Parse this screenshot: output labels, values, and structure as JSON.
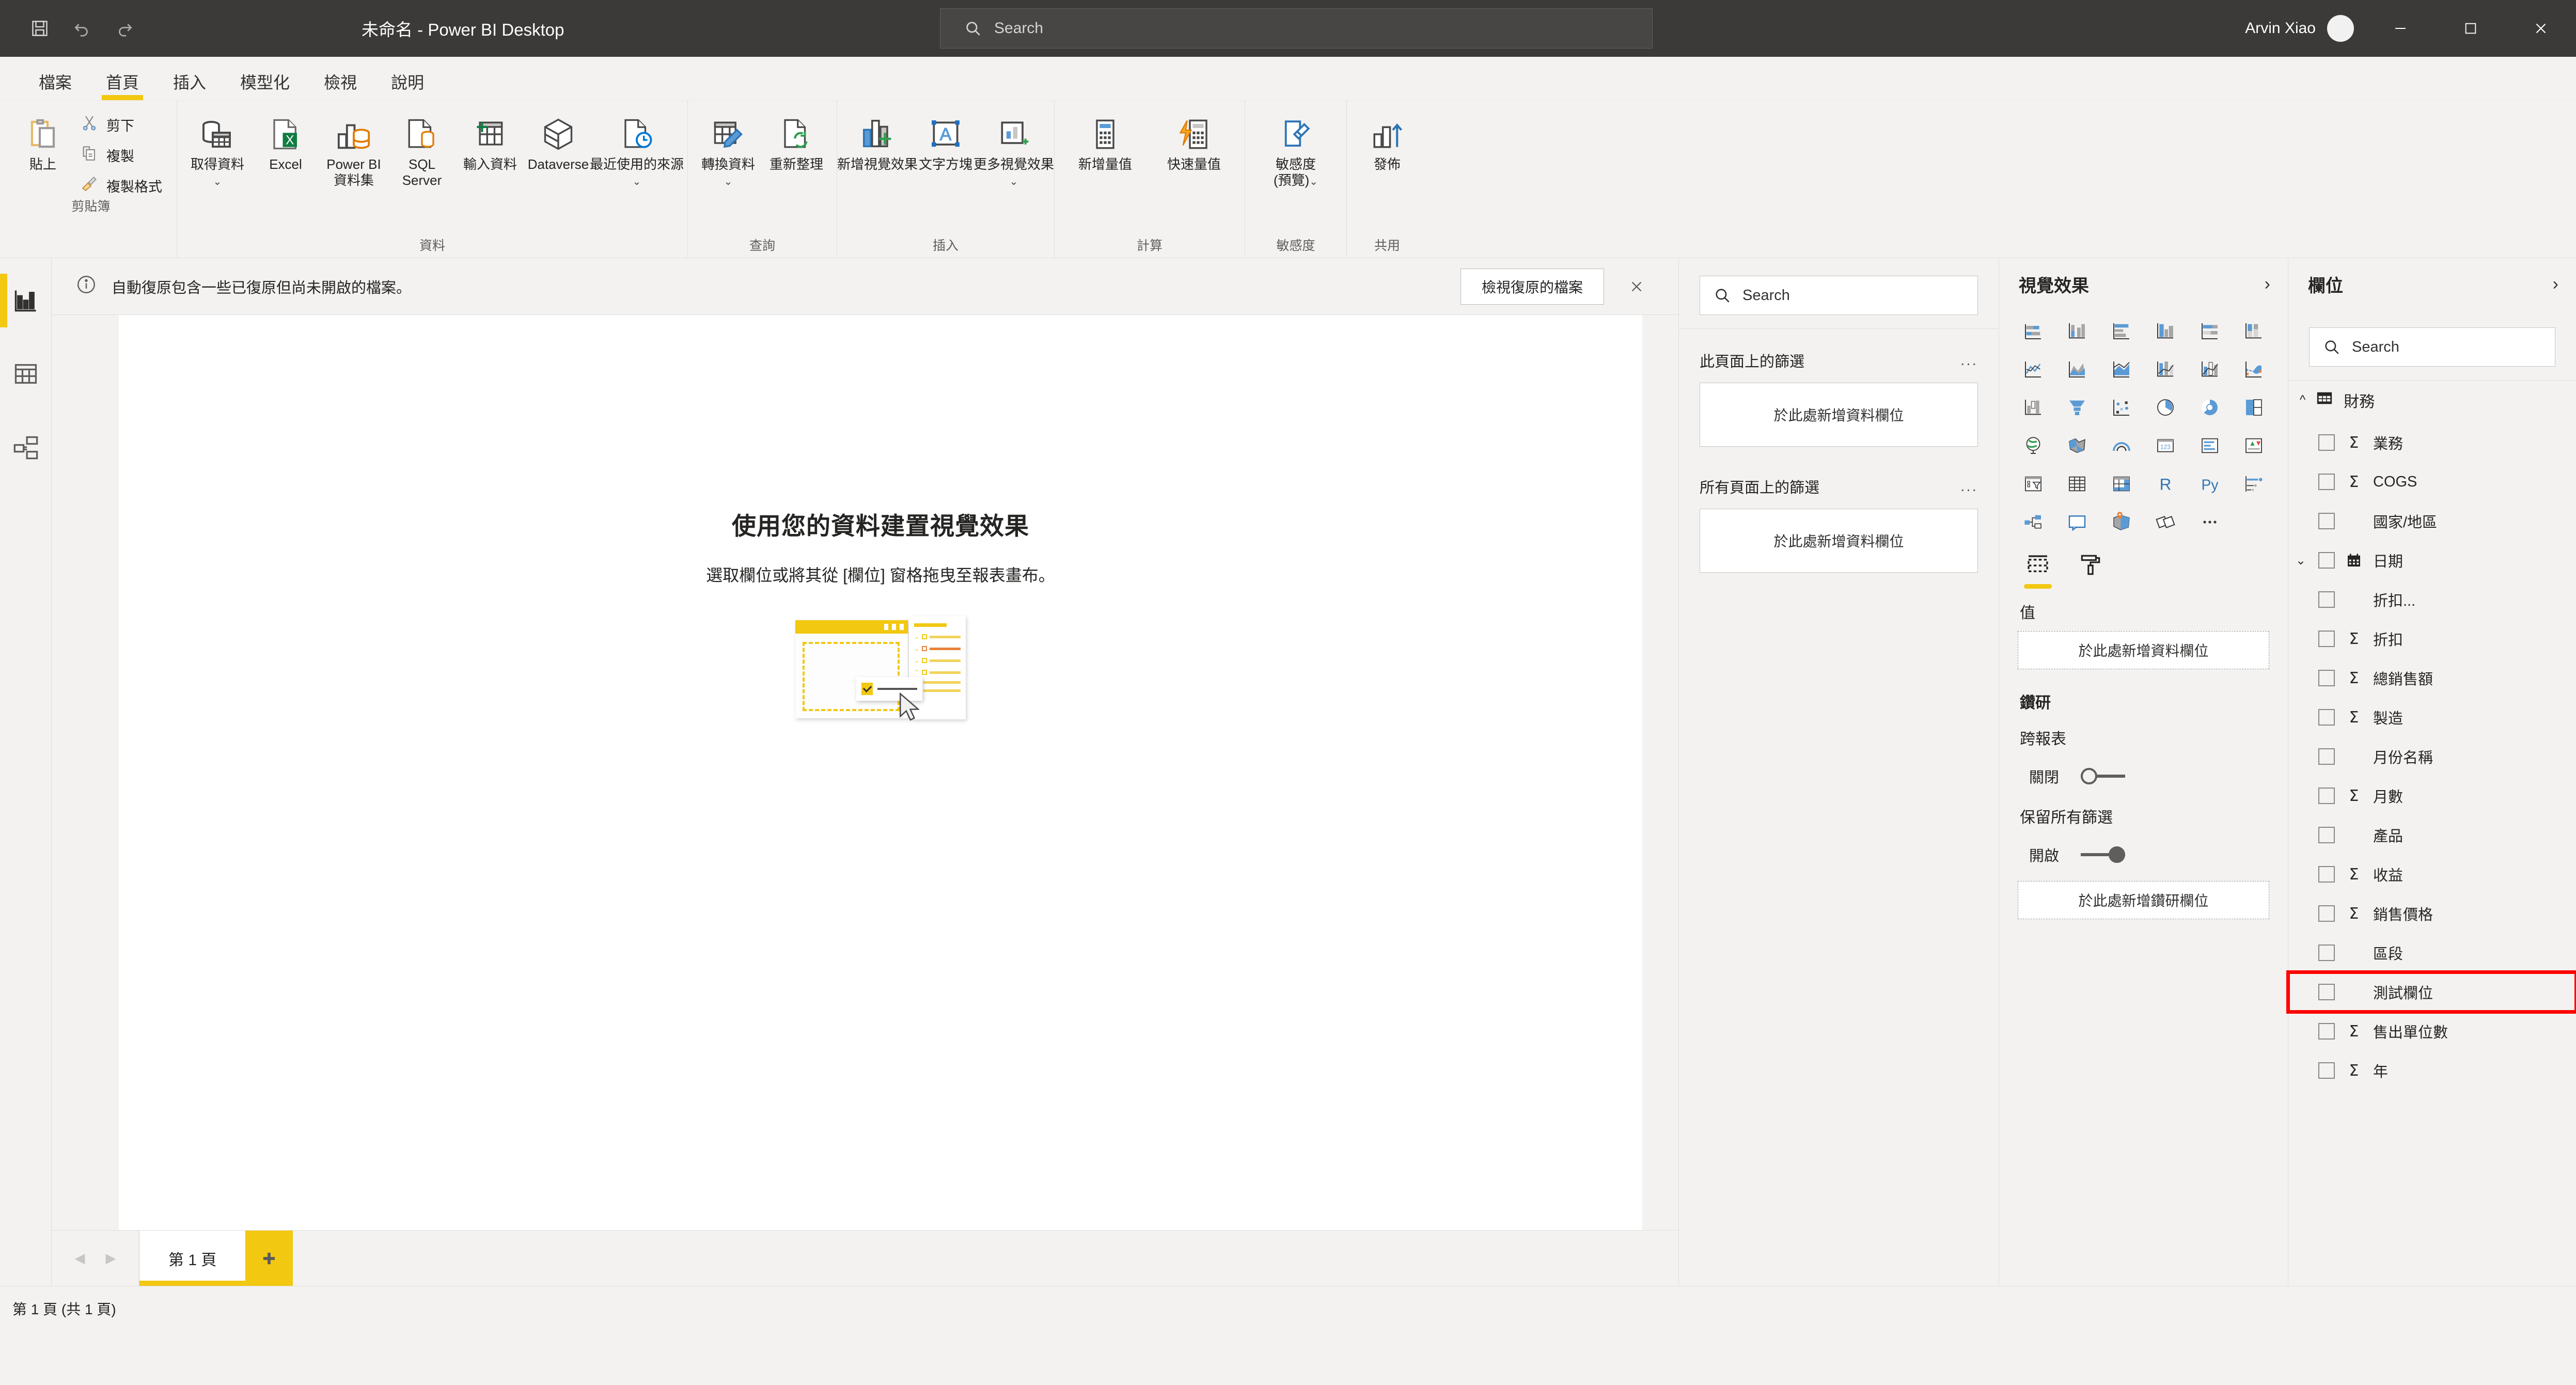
{
  "titlebar": {
    "quick_access": [
      {
        "name": "save",
        "icon": "save-icon"
      },
      {
        "name": "undo",
        "icon": "undo-icon"
      },
      {
        "name": "redo",
        "icon": "redo-icon"
      }
    ],
    "app_title": "未命名 - Power BI Desktop",
    "search_placeholder": "Search",
    "user_name": "Arvin Xiao",
    "window_controls": [
      "minimize",
      "maximize",
      "close"
    ]
  },
  "ribbon": {
    "tabs": [
      {
        "label": "檔案",
        "active": false
      },
      {
        "label": "首頁",
        "active": true
      },
      {
        "label": "插入",
        "active": false
      },
      {
        "label": "模型化",
        "active": false
      },
      {
        "label": "檢視",
        "active": false
      },
      {
        "label": "說明",
        "active": false
      }
    ],
    "groups": {
      "clipboard": {
        "label": "剪貼簿",
        "paste": "貼上",
        "cut": "剪下",
        "copy": "複製",
        "format_painter": "複製格式"
      },
      "data": {
        "label": "資料",
        "items": [
          {
            "label": "取得資料",
            "caret": true
          },
          {
            "label": "Excel",
            "caret": false
          },
          {
            "label": "Power BI 資料集",
            "caret": false
          },
          {
            "label": "SQL Server",
            "caret": false
          },
          {
            "label": "輸入資料",
            "caret": false
          },
          {
            "label": "Dataverse",
            "caret": false
          },
          {
            "label": "最近使用的來源",
            "caret": true
          }
        ]
      },
      "query": {
        "label": "查詢",
        "items": [
          {
            "label": "轉換資料",
            "caret": true
          },
          {
            "label": "重新整理",
            "caret": false
          }
        ]
      },
      "insert": {
        "label": "插入",
        "items": [
          {
            "label": "新增視覺效果",
            "caret": false
          },
          {
            "label": "文字方塊",
            "caret": false
          },
          {
            "label": "更多視覺效果",
            "caret": true
          }
        ]
      },
      "calculations": {
        "label": "計算",
        "items": [
          {
            "label": "新增量值",
            "caret": false
          },
          {
            "label": "快速量值",
            "caret": false
          }
        ]
      },
      "sensitivity": {
        "label": "敏感度",
        "items": [
          {
            "label": "敏感度 (預覽)",
            "caret": true
          }
        ]
      },
      "share": {
        "label": "共用",
        "items": [
          {
            "label": "發佈",
            "caret": false
          }
        ]
      }
    }
  },
  "viewbar": {
    "items": [
      {
        "name": "report-view",
        "icon": "bar-chart-icon",
        "active": true
      },
      {
        "name": "data-view",
        "icon": "table-icon",
        "active": false
      },
      {
        "name": "model-view",
        "icon": "model-icon",
        "active": false
      }
    ]
  },
  "notice": {
    "icon": "info-icon",
    "text": "自動復原包含一些已復原但尚未開啟的檔案。",
    "button": "檢視復原的檔案",
    "close_icon": "close-icon"
  },
  "canvas": {
    "title": "使用您的資料建置視覺效果",
    "subtitle": "選取欄位或將其從 [欄位] 窗格拖曳至報表畫布。"
  },
  "pagebar": {
    "prev_icon": "chevron-left-icon",
    "next_icon": "chevron-right-icon",
    "tabs": [
      {
        "label": "第 1 頁",
        "active": true
      }
    ],
    "add_icon": "plus-icon"
  },
  "statusbar": {
    "text": "第 1 頁 (共 1 頁)"
  },
  "filters": {
    "search_placeholder": "Search",
    "sections": [
      {
        "title": "此頁面上的篩選",
        "dropzone": "於此處新增資料欄位",
        "menu": "..."
      },
      {
        "title": "所有頁面上的篩選",
        "dropzone": "於此處新增資料欄位",
        "menu": "..."
      }
    ]
  },
  "visualizations": {
    "title": "視覺效果",
    "collapse_icon": "chevron-right-icon",
    "gallery": [
      "stacked-bar-chart",
      "stacked-column-chart",
      "clustered-bar-chart",
      "clustered-column-chart",
      "100-stacked-bar-chart",
      "100-stacked-column-chart",
      "line-chart",
      "area-chart",
      "stacked-area-chart",
      "line-stacked-column-chart",
      "line-clustered-column-chart",
      "ribbon-chart",
      "waterfall-chart",
      "funnel-chart",
      "scatter-chart",
      "pie-chart",
      "donut-chart",
      "treemap",
      "map",
      "filled-map",
      "arcgis-map",
      "card",
      "multi-row-card",
      "kpi",
      "slicer",
      "table",
      "matrix",
      "r-script-visual",
      "python-visual",
      "key-influencers",
      "decomposition-tree",
      "smart-narrative",
      "azure-map",
      "paginated-report",
      "more-visuals"
    ],
    "tabs": [
      {
        "name": "fields-tab",
        "icon": "fields-wells-icon",
        "active": true
      },
      {
        "name": "format-tab",
        "icon": "paint-roller-icon",
        "active": false
      }
    ],
    "values_label": "值",
    "values_dropzone": "於此處新增資料欄位",
    "drillthrough_label": "鑽研",
    "cross_report_label": "跨報表",
    "cross_report_state": "關閉",
    "keep_all_filters_label": "保留所有篩選",
    "keep_all_filters_state": "開啟",
    "drillthrough_dropzone": "於此處新增鑽研欄位"
  },
  "fields": {
    "title": "欄位",
    "collapse_icon": "chevron-right-icon",
    "search_placeholder": "Search",
    "table": {
      "name": "財務",
      "expanded": true,
      "icon": "table-icon"
    },
    "items": [
      {
        "label": "業務",
        "measure": true,
        "icon": "sigma-icon",
        "expandable": false,
        "highlight": false
      },
      {
        "label": "COGS",
        "measure": true,
        "icon": "sigma-icon",
        "expandable": false,
        "highlight": false
      },
      {
        "label": "國家/地區",
        "measure": false,
        "icon": "",
        "expandable": false,
        "highlight": false
      },
      {
        "label": "日期",
        "measure": false,
        "icon": "calendar-icon",
        "expandable": true,
        "highlight": false
      },
      {
        "label": "折扣...",
        "measure": false,
        "icon": "",
        "expandable": false,
        "highlight": false
      },
      {
        "label": "折扣",
        "measure": true,
        "icon": "sigma-icon",
        "expandable": false,
        "highlight": false
      },
      {
        "label": "總銷售額",
        "measure": true,
        "icon": "sigma-icon",
        "expandable": false,
        "highlight": false
      },
      {
        "label": "製造",
        "measure": true,
        "icon": "sigma-icon",
        "expandable": false,
        "highlight": false
      },
      {
        "label": "月份名稱",
        "measure": false,
        "icon": "",
        "expandable": false,
        "highlight": false
      },
      {
        "label": "月數",
        "measure": true,
        "icon": "sigma-icon",
        "expandable": false,
        "highlight": false
      },
      {
        "label": "產品",
        "measure": false,
        "icon": "",
        "expandable": false,
        "highlight": false
      },
      {
        "label": "收益",
        "measure": true,
        "icon": "sigma-icon",
        "expandable": false,
        "highlight": false
      },
      {
        "label": "銷售價格",
        "measure": true,
        "icon": "sigma-icon",
        "expandable": false,
        "highlight": false
      },
      {
        "label": "區段",
        "measure": false,
        "icon": "",
        "expandable": false,
        "highlight": false
      },
      {
        "label": "測試欄位",
        "measure": false,
        "icon": "",
        "expandable": false,
        "highlight": true
      },
      {
        "label": "售出單位數",
        "measure": true,
        "icon": "sigma-icon",
        "expandable": false,
        "highlight": false
      },
      {
        "label": "年",
        "measure": true,
        "icon": "sigma-icon",
        "expandable": false,
        "highlight": false
      }
    ]
  },
  "colors": {
    "accent": "#f2c811",
    "titlebar": "#3b3a39",
    "pane_bg": "#f3f2f1",
    "highlight": "#ff0000"
  }
}
